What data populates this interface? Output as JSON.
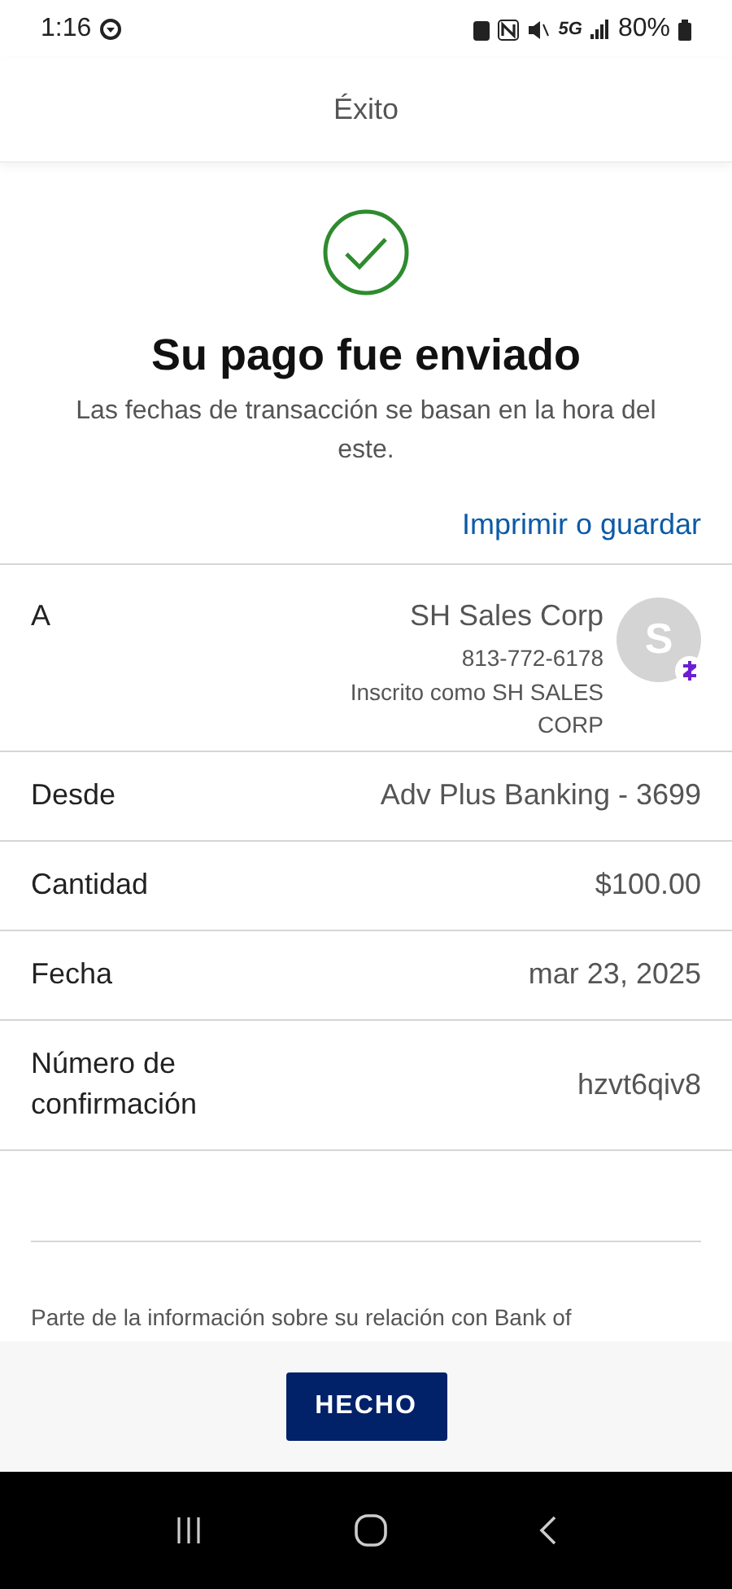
{
  "status_bar": {
    "time": "1:16",
    "network": "5G",
    "battery": "80%"
  },
  "header": {
    "title": "Éxito"
  },
  "confirmation": {
    "heading": "Su pago fue enviado",
    "note": "Las fechas de transacción se basan en la hora del este.",
    "print_link": "Imprimir o guardar"
  },
  "details": [
    {
      "kind": "payee",
      "label": "A",
      "name": "SH Sales Corp",
      "phone": "813-772-6178",
      "enrolled": "Inscrito como SH SALES CORP",
      "avatar": "S"
    },
    {
      "kind": "plain",
      "label": "Desde",
      "value": "Adv Plus Banking - 3699"
    },
    {
      "kind": "plain",
      "label": "Cantidad",
      "value": "$100.00"
    },
    {
      "kind": "plain",
      "label": "Fecha",
      "value": "mar 23, 2025"
    },
    {
      "kind": "plain",
      "label": "Número de confirmación",
      "value": "hzvt6qiv8"
    }
  ],
  "disclaimer": "Parte de la información sobre su relación con Bank of",
  "done_button": "HECHO"
}
